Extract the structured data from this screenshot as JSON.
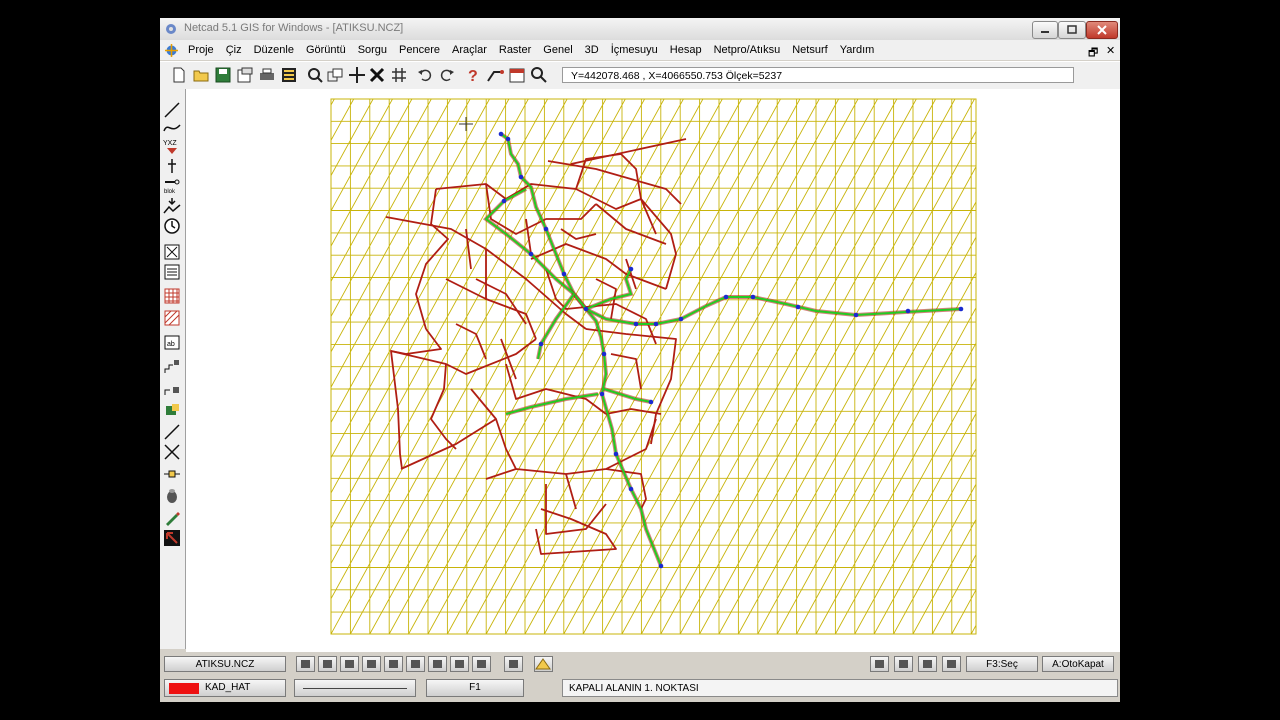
{
  "window": {
    "title": "Netcad 5.1 GIS for Windows - [ATIKSU.NCZ]"
  },
  "menu": {
    "items": [
      "Proje",
      "Çiz",
      "Düzenle",
      "Görüntü",
      "Sorgu",
      "Pencere",
      "Araçlar",
      "Raster",
      "Genel",
      "3D",
      "İçmesuyu",
      "Hesap",
      "Netpro/Atıksu",
      "Netsurf",
      "Yardım"
    ],
    "restore_symbol": "🗗",
    "close_symbol": "✕"
  },
  "toolbar": {
    "coordinate_readout": "Y=442078.468 , X=4066550.753 Ölçek=5237"
  },
  "bottom_bar": {
    "layer_button": "ATIKSU.NCZ",
    "select_button": "F3:Seç",
    "autoclose_button": "A:OtoKapat"
  },
  "status_bar": {
    "line_layer": "KAD_HAT",
    "linetype": "",
    "function_key": "F1",
    "prompt": "KAPALI ALANIN 1. NOKTASI"
  },
  "colors": {
    "grid": "#c8b40a",
    "roads": "#b01e14",
    "pipeline": "#22cc22",
    "nodes": "#1a2ad0",
    "layer_color": "#ee1111"
  }
}
